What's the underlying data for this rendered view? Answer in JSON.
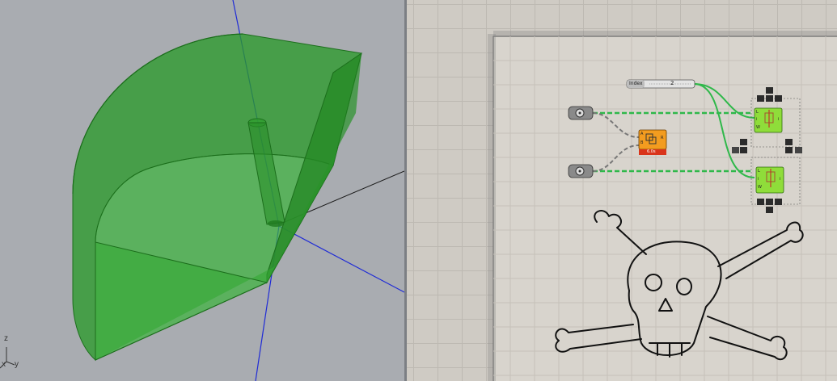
{
  "viewport": {
    "axis_labels": {
      "z": "z",
      "x": "x",
      "y": "y"
    },
    "colors": {
      "background": "#a9acb1",
      "solid": "#2f9e2f",
      "axis_blue": "#1f2bd6"
    }
  },
  "grasshopper": {
    "slider": {
      "name": "Index",
      "value": "2",
      "accent": "#d8d8d8"
    },
    "param_left_top": {
      "icon": "point-param-icon"
    },
    "param_left_bottom": {
      "icon": "point-param-icon"
    },
    "orange_component": {
      "inputs": [
        "A",
        "B"
      ],
      "output": "R",
      "status": "6.0s",
      "color": "#f39c1f",
      "error_color": "#d9341b"
    },
    "green_component_top": {
      "inputs": [
        "L",
        "i",
        "W"
      ],
      "output": "i",
      "color": "#8fdd3a"
    },
    "green_component_bottom": {
      "inputs": [
        "L",
        "i",
        "W"
      ],
      "output": "i",
      "color": "#8fdd3a"
    },
    "wire_color": "#2fb84a",
    "sketch": "skull-and-crossbones"
  }
}
